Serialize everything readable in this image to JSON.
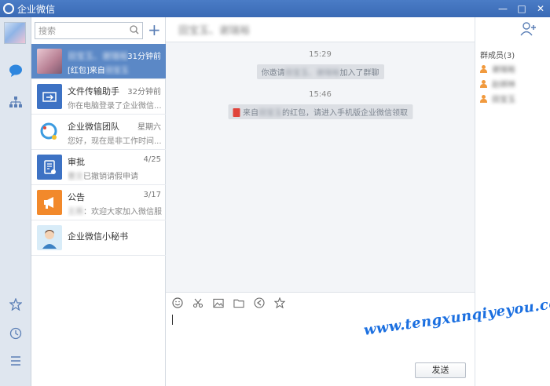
{
  "window": {
    "title": "企业微信",
    "minimize": "—",
    "maximize": "□",
    "close": "✕"
  },
  "search": {
    "placeholder": "搜索"
  },
  "conversations": [
    {
      "name": "田宝玉、谢瑞裕",
      "time": "31分钟前",
      "preview_prefix": "[红包]来自",
      "preview_blur": "田宝玉"
    },
    {
      "name": "文件传输助手",
      "time": "32分钟前",
      "preview": "你在电脑登录了企业微信..."
    },
    {
      "name": "企业微信团队",
      "time": "星期六",
      "preview": "您好，现在是非工作时间..."
    },
    {
      "name": "审批",
      "time": "4/25",
      "preview_blur": "曹文",
      "preview": "已撤销请假申请"
    },
    {
      "name": "公告",
      "time": "3/17",
      "preview_blur": "王燕",
      "preview": "：欢迎大家加入微信服..."
    },
    {
      "name": "企业微信小秘书",
      "time": "",
      "preview": ""
    }
  ],
  "chat": {
    "header_title": "田宝玉、谢瑞裕",
    "time1": "15:29",
    "sys1_prefix": "你邀请",
    "sys1_blur": "田宝玉、谢瑞裕",
    "sys1_suffix": "加入了群聊",
    "time2": "15:46",
    "sys2_prefix": "来自",
    "sys2_blur": "田宝玉",
    "sys2_suffix": "的红包，请进入手机版企业微信领取",
    "send_label": "发送"
  },
  "members": {
    "title": "群成员(3)",
    "list": [
      "谢瑞裕",
      "赵绑林",
      "田宝玉"
    ]
  },
  "watermark": "www.tengxunqiyeyou.com",
  "colors": {
    "accent": "#5b88c6",
    "titlebar": "#4a7cc6",
    "member_icon": "#f19a3e",
    "watermark": "#1b6fe0"
  }
}
